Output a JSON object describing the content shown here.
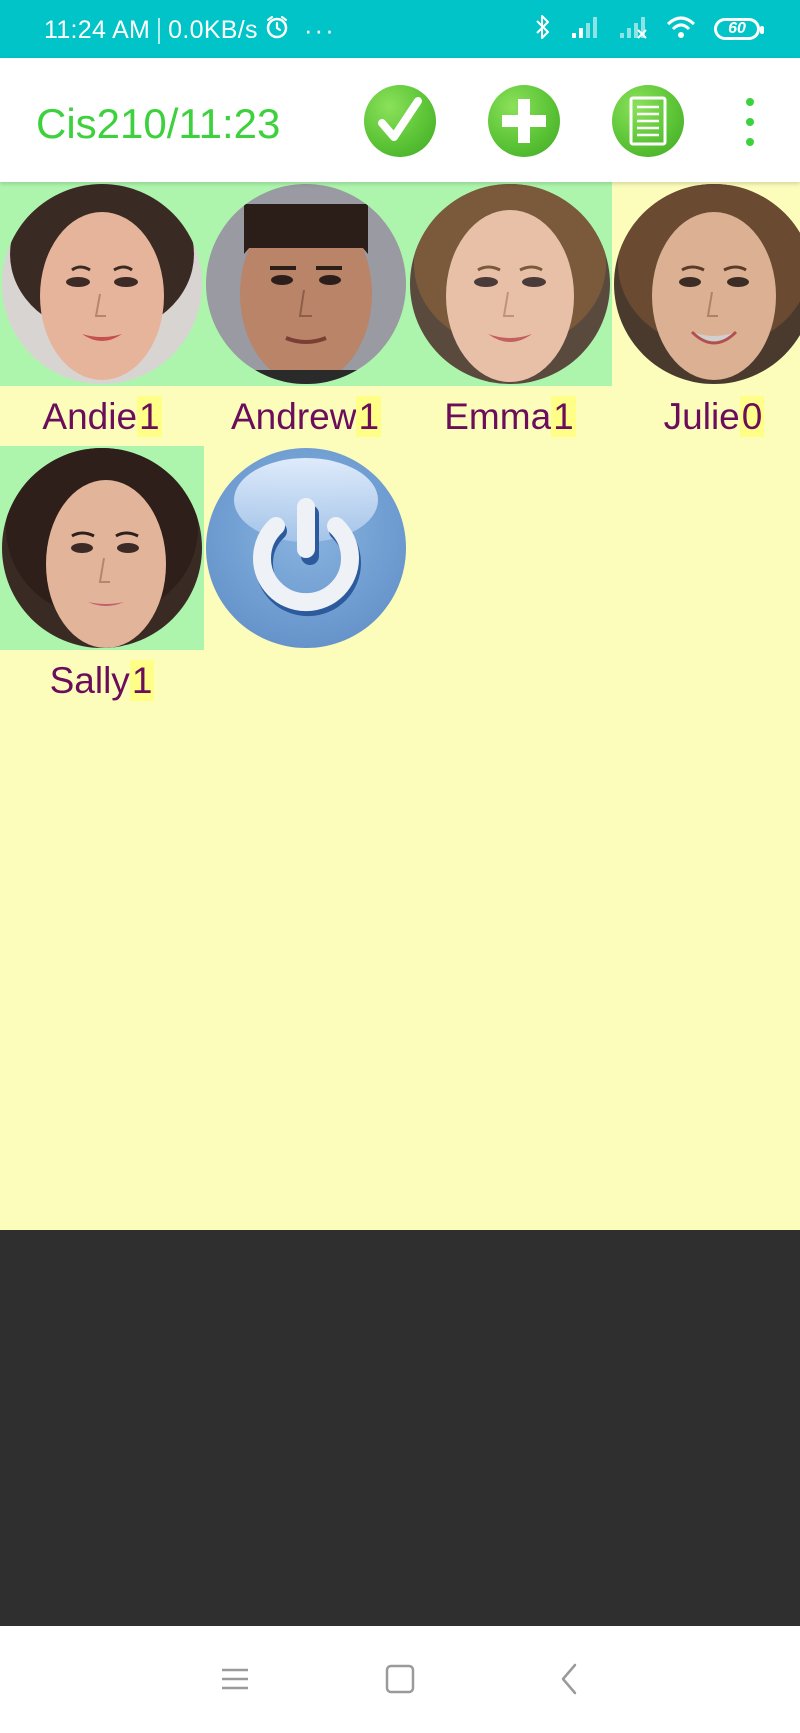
{
  "status_bar": {
    "time": "11:24 AM",
    "network_speed": "0.0KB/s",
    "more_indicator": "···",
    "battery_level": "60",
    "icons": [
      "alarm-icon",
      "bluetooth-icon",
      "signal-icon",
      "signal-no-service-icon",
      "wifi-icon",
      "battery-icon"
    ]
  },
  "app_bar": {
    "title": "Cis210/11:23",
    "actions": [
      "check-icon",
      "add-icon",
      "list-icon",
      "more-vert-icon"
    ],
    "accent_color": "#3dd13d"
  },
  "students": [
    {
      "name": "Andie",
      "count": "1",
      "highlighted": true
    },
    {
      "name": "Andrew",
      "count": "1",
      "highlighted": true
    },
    {
      "name": "Emma",
      "count": "1",
      "highlighted": true
    },
    {
      "name": "Julie",
      "count": "0",
      "highlighted": false
    },
    {
      "name": "Sally",
      "count": "1",
      "highlighted": true
    }
  ],
  "power_button": {
    "icon": "power-icon"
  },
  "nav_bar": {
    "buttons": [
      "menu-icon",
      "home-square-icon",
      "back-chevron-icon"
    ]
  },
  "colors": {
    "status_bar": "#00c4c7",
    "content_background": "#fcfcbb",
    "highlight": "#adf5ad",
    "name_text": "#6b0d5b",
    "count_highlight": "#ffff88",
    "empty_area": "#2f2f2f"
  }
}
